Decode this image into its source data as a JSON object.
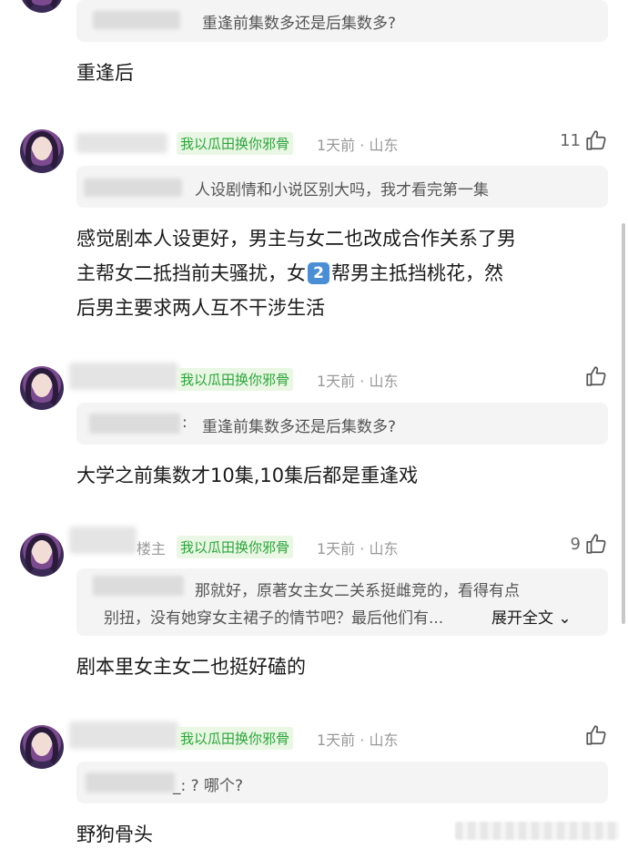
{
  "colors": {
    "badge_green": "#2aa53a",
    "meta_gray": "#999999",
    "quote_bg": "#f4f4f4"
  },
  "comments": [
    {
      "quote": "重逢前集数多还是后集数多?",
      "reply": "重逢后"
    },
    {
      "badge": "我以瓜田换你邪骨",
      "meta": "1天前 · 山东",
      "likes": "11",
      "quote": "人设剧情和小说区别大吗，我才看完第一集",
      "reply_line1": "感觉剧本人设更好，男主与女二也改成合作关系了男",
      "reply_line2a": "主帮女二抵挡前夫骚扰，女",
      "reply_emoji": "2",
      "reply_line2b": "帮男主抵挡桃花，然",
      "reply_line3": "后男主要求两人互不干涉生活"
    },
    {
      "badge": "我以瓜田换你邪骨",
      "meta": "1天前 · 山东",
      "quote_prefix": ":",
      "quote": "重逢前集数多还是后集数多?",
      "reply": "大学之前集数才10集,10集后都是重逢戏"
    },
    {
      "name_suffix": "楼主",
      "badge": "我以瓜田换你邪骨",
      "meta": "1天前 · 山东",
      "likes": "9",
      "quote_line1": "那就好，原著女主女二关系挺雌竞的，看得有点",
      "quote_line2": "别扭，没有她穿女主裙子的情节吧？最后他们有...",
      "expand": "展开全文",
      "reply": "剧本里女主女二也挺好磕的"
    },
    {
      "badge": "我以瓜田换你邪骨",
      "meta": "1天前 · 山东",
      "quote": "_: ? 哪个?",
      "reply": "野狗骨头"
    }
  ]
}
